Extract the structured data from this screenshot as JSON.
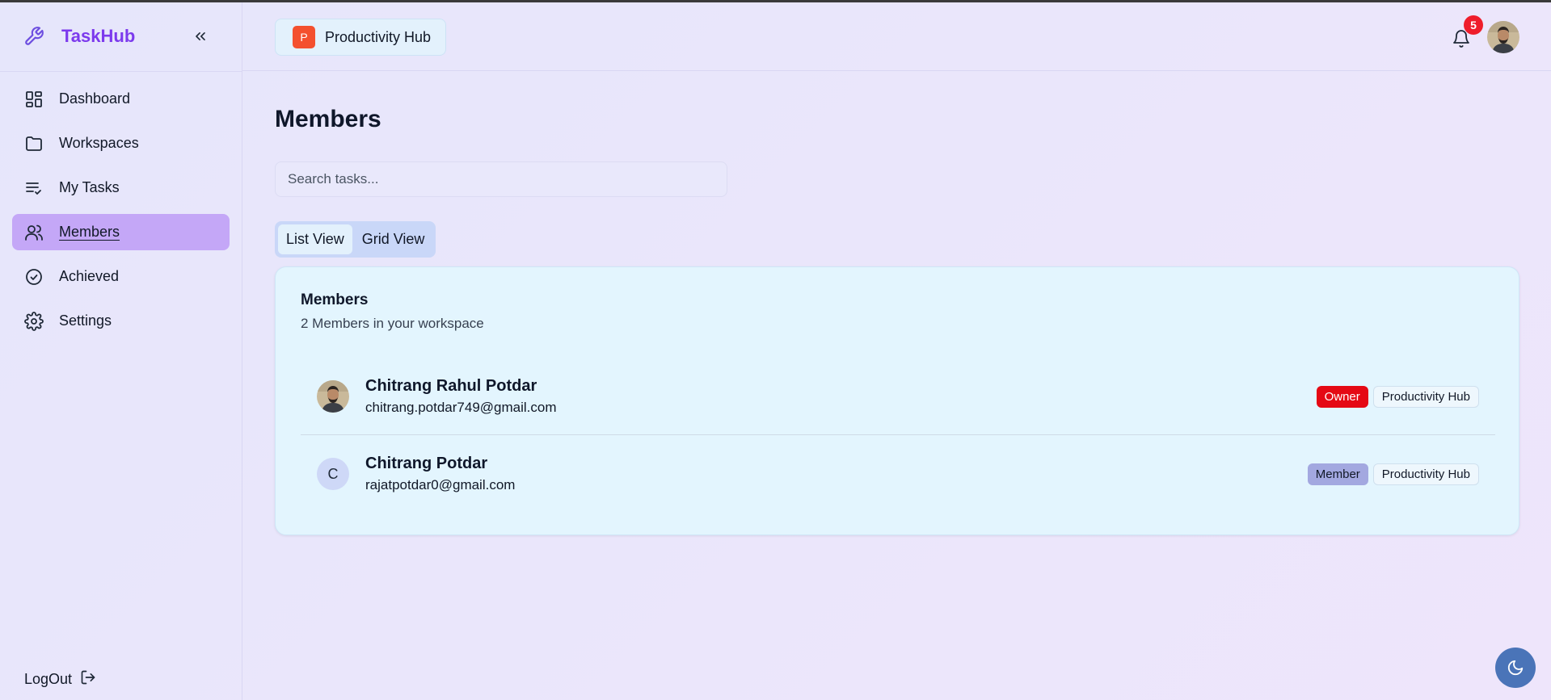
{
  "app": {
    "name": "TaskHub",
    "accent": "#7c3aed"
  },
  "sidebar": {
    "items": [
      {
        "label": "Dashboard",
        "icon": "dashboard-icon"
      },
      {
        "label": "Workspaces",
        "icon": "folder-icon"
      },
      {
        "label": "My Tasks",
        "icon": "list-check-icon"
      },
      {
        "label": "Members",
        "icon": "users-icon",
        "active": true
      },
      {
        "label": "Achieved",
        "icon": "check-circle-icon"
      },
      {
        "label": "Settings",
        "icon": "gear-icon"
      }
    ],
    "logout_label": "LogOut"
  },
  "header": {
    "workspace": {
      "initial": "P",
      "name": "Productivity Hub",
      "color": "#f4502e"
    },
    "notification_count": "5"
  },
  "main": {
    "title": "Members",
    "search_placeholder": "Search tasks...",
    "view_toggle": {
      "list": "List View",
      "grid": "Grid View",
      "selected": "List View"
    }
  },
  "members_card": {
    "title": "Members",
    "subtitle": "2 Members in your workspace",
    "members": [
      {
        "name": "Chitrang Rahul Potdar",
        "email": "chitrang.potdar749@gmail.com",
        "role": "Owner",
        "workspace": "Productivity Hub",
        "avatar": "photo"
      },
      {
        "name": "Chitrang Potdar",
        "email": "rajatpotdar0@gmail.com",
        "role": "Member",
        "workspace": "Productivity Hub",
        "avatar_initial": "C"
      }
    ]
  },
  "colors": {
    "owner_tag": "#e50914",
    "member_tag": "#a3a8e0",
    "active_nav": "#c4a7f7",
    "theme_button": "#4a74b8"
  }
}
